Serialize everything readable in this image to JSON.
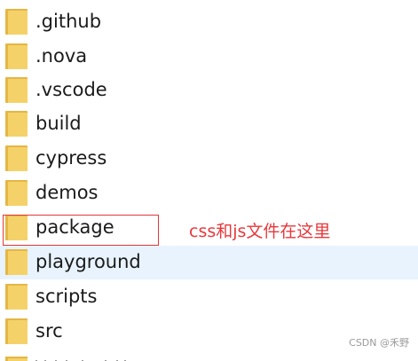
{
  "folders": [
    {
      "name": ".github"
    },
    {
      "name": ".nova"
    },
    {
      "name": ".vscode"
    },
    {
      "name": "build"
    },
    {
      "name": "cypress"
    },
    {
      "name": "demos"
    },
    {
      "name": "package"
    },
    {
      "name": "playground"
    },
    {
      "name": "scripts"
    },
    {
      "name": "src"
    }
  ],
  "annotation": {
    "text": "css和js文件在这里",
    "color": "#e8383b"
  },
  "watermark": "CSDN @禾野",
  "colors": {
    "folder_body": "#f5d269",
    "folder_back": "#e5b643",
    "hover_row": "#e8f3fd",
    "highlight_border": "#e0383a"
  },
  "icons": {
    "folder": "folder-icon"
  }
}
